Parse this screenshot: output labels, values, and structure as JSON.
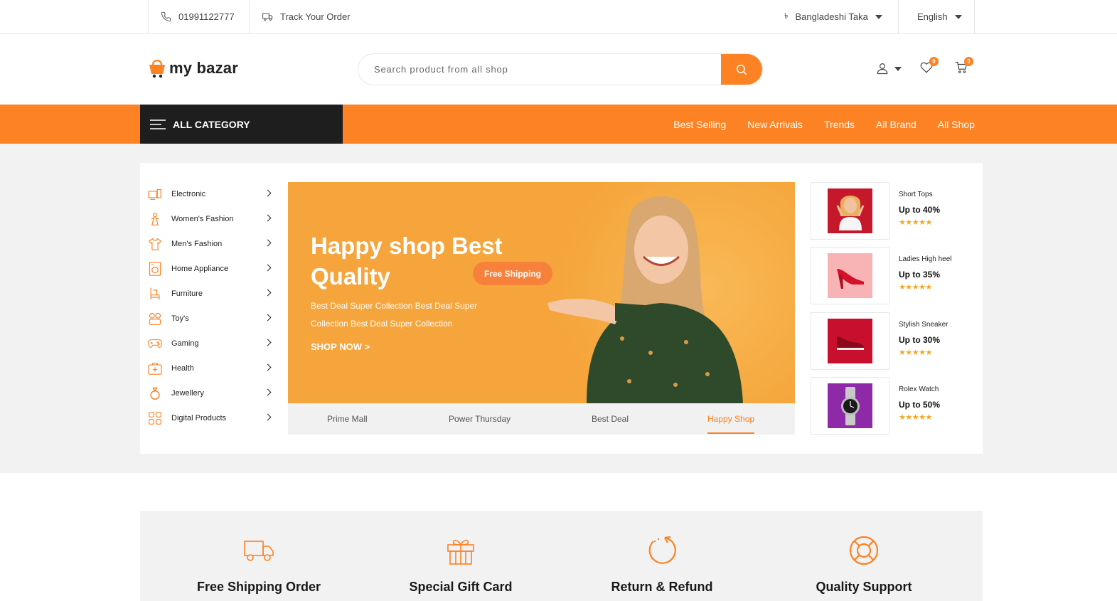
{
  "topbar": {
    "phone": "01991122777",
    "track_order": "Track Your Order",
    "currency_symbol": "৳",
    "currency": "Bangladeshi Taka",
    "language": "English"
  },
  "header": {
    "logo_text_1": "my",
    "logo_text_2": "bazar",
    "search_placeholder": "Search product from all shop",
    "wishlist_count": "0",
    "cart_count": "0"
  },
  "nav": {
    "all_category": "ALL CATEGORY",
    "links": [
      "Best Selling",
      "New Arrivals",
      "Trends",
      "All Brand",
      "All Shop"
    ]
  },
  "categories": [
    {
      "label": "Electronic",
      "icon": "electronic-icon"
    },
    {
      "label": "Women's Fashion",
      "icon": "womens-fashion-icon"
    },
    {
      "label": "Men's Fashion",
      "icon": "mens-fashion-icon"
    },
    {
      "label": "Home Appliance",
      "icon": "home-appliance-icon"
    },
    {
      "label": "Furniture",
      "icon": "furniture-icon"
    },
    {
      "label": "Toy's",
      "icon": "toys-icon"
    },
    {
      "label": "Gaming",
      "icon": "gaming-icon"
    },
    {
      "label": "Health",
      "icon": "health-icon"
    },
    {
      "label": "Jewellery",
      "icon": "jewellery-icon"
    },
    {
      "label": "Digital Products",
      "icon": "digital-products-icon"
    }
  ],
  "banner": {
    "title": "Happy shop Best Quality",
    "badge": "Free Shipping",
    "description": "Best Deal Super Collection Best Deal Super Collection Best Deal Super Collection",
    "cta": "SHOP NOW >"
  },
  "tabs": [
    "Prime Mall",
    "Power Thursday",
    "Best Deal",
    "Happy Shop"
  ],
  "active_tab": "Happy Shop",
  "promos": [
    {
      "name": "Short Tops",
      "offer": "Up to 40%",
      "stars": "★★★★★",
      "color": "#c5182b"
    },
    {
      "name": "Ladies High heel",
      "offer": "Up to 35%",
      "stars": "★★★★★",
      "color": "#f8b4b4"
    },
    {
      "name": "Stylish Sneaker",
      "offer": "Up to 30%",
      "stars": "★★★★★",
      "color": "#c8102e"
    },
    {
      "name": "Rolex Watch",
      "offer": "Up to 50%",
      "stars": "★★★★★",
      "color": "#8e2aa8"
    }
  ],
  "features": [
    {
      "title": "Free Shipping Order",
      "icon": "truck-icon"
    },
    {
      "title": "Special Gift Card",
      "icon": "gift-icon"
    },
    {
      "title": "Return & Refund",
      "icon": "refund-icon"
    },
    {
      "title": "Quality Support",
      "icon": "support-icon"
    }
  ],
  "colors": {
    "accent": "#fc8223",
    "dark": "#1e1e1e",
    "banner": "#f5a53b"
  }
}
